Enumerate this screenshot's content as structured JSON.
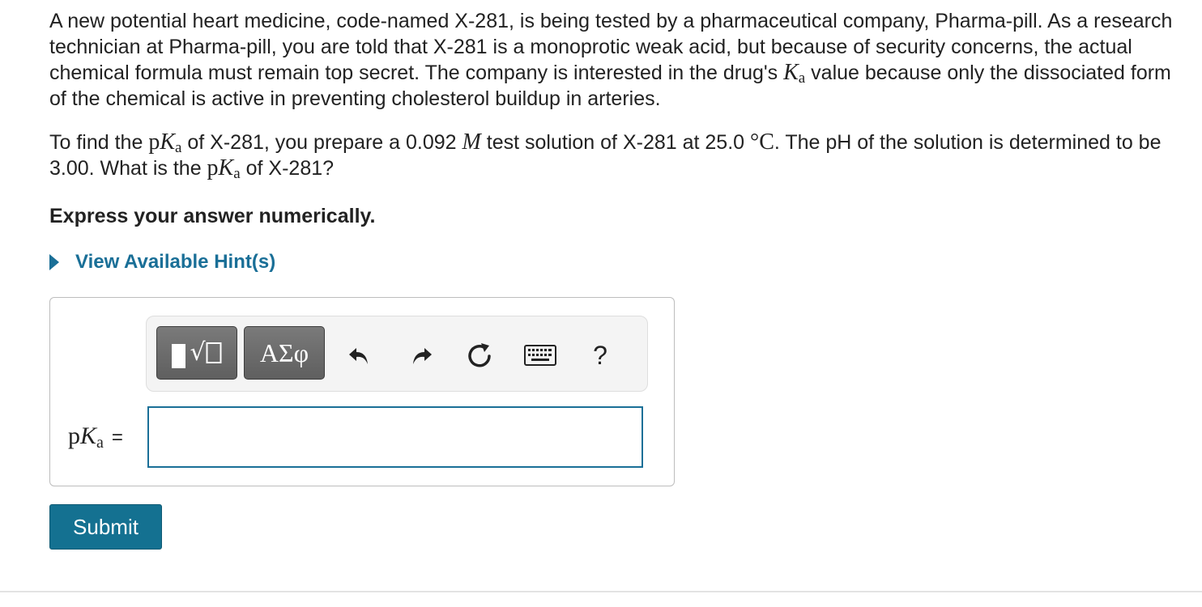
{
  "question": {
    "para1": {
      "text_a": "A new potential heart medicine, code-named X-281, is being tested by a pharmaceutical company, Pharma-pill. As a research technician at Pharma-pill, you are told that X-281 is a monoprotic weak acid, but because of security concerns, the actual chemical formula must remain top secret. The company is interested in the drug's ",
      "ka_symbol": "K",
      "ka_sub": "a",
      "text_b": " value because only the dissociated form of the chemical is active in preventing cholesterol buildup in arteries."
    },
    "para2": {
      "text_a": "To find the ",
      "pka_p": "p",
      "pka_k": "K",
      "pka_sub": "a",
      "text_b": " of X-281, you prepare a 0.092 ",
      "molar_unit": "M",
      "text_c": " test solution of X-281 at 25.0 ",
      "degree_unit": "°C",
      "text_d": ". The pH of the solution is determined to be 3.00. What is the ",
      "text_e": " of X-281?"
    },
    "instruction": "Express your answer numerically."
  },
  "hints": {
    "label": "View Available Hint(s)"
  },
  "toolbar": {
    "templates_symbol": "√",
    "greek_label": "ΑΣφ",
    "help_label": "?",
    "icons": [
      "templates-icon",
      "greek-letters-icon",
      "undo-icon",
      "redo-icon",
      "reset-icon",
      "keyboard-icon",
      "help-icon"
    ]
  },
  "answer": {
    "variable_p": "p",
    "variable_k": "K",
    "variable_sub": "a",
    "equals": "=",
    "value": ""
  },
  "submit": {
    "label": "Submit"
  },
  "colors": {
    "accent": "#1a6f97",
    "submit_bg": "#147191",
    "toolbar_bg": "#f4f4f4",
    "tool_button": "#6b6b6b"
  }
}
